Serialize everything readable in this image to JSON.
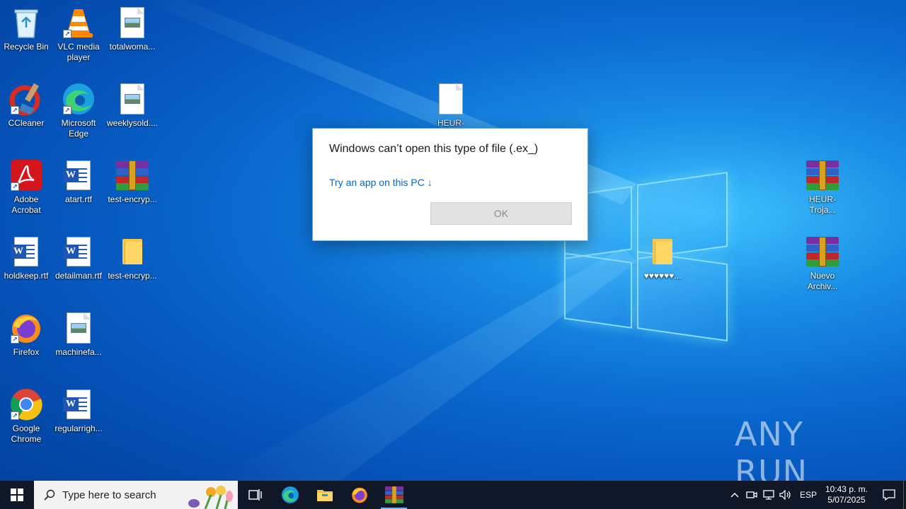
{
  "desktop_icons": [
    {
      "label": "Recycle Bin"
    },
    {
      "label": "VLC media\nplayer"
    },
    {
      "label": "totalwoma..."
    },
    {
      "label": "CCleaner"
    },
    {
      "label": "Microsoft\nEdge"
    },
    {
      "label": "weeklysold...."
    },
    {
      "label": "Adobe\nAcrobat"
    },
    {
      "label": "atart.rtf"
    },
    {
      "label": "test-encryp..."
    },
    {
      "label": "holdkeep.rtf"
    },
    {
      "label": "detailman.rtf"
    },
    {
      "label": "test-encryp..."
    },
    {
      "label": "Firefox"
    },
    {
      "label": "machinefa..."
    },
    {
      "label": "Google\nChrome"
    },
    {
      "label": "regularrigh..."
    },
    {
      "label": "HEUR-Troja..."
    },
    {
      "label": "♥♥♥♥♥♥..."
    },
    {
      "label": "HEUR-Troja..."
    },
    {
      "label": "Nuevo\nArchiv..."
    }
  ],
  "dialog": {
    "title": "Windows can’t open this type of file (.ex_)",
    "link": "Try an app on this PC ↓",
    "ok_label": "OK"
  },
  "watermark": "ANY RUN",
  "taskbar": {
    "search_placeholder": "Type here to search",
    "language": "ESP",
    "time": "10:43 p. m.",
    "date": "5/07/2025"
  }
}
